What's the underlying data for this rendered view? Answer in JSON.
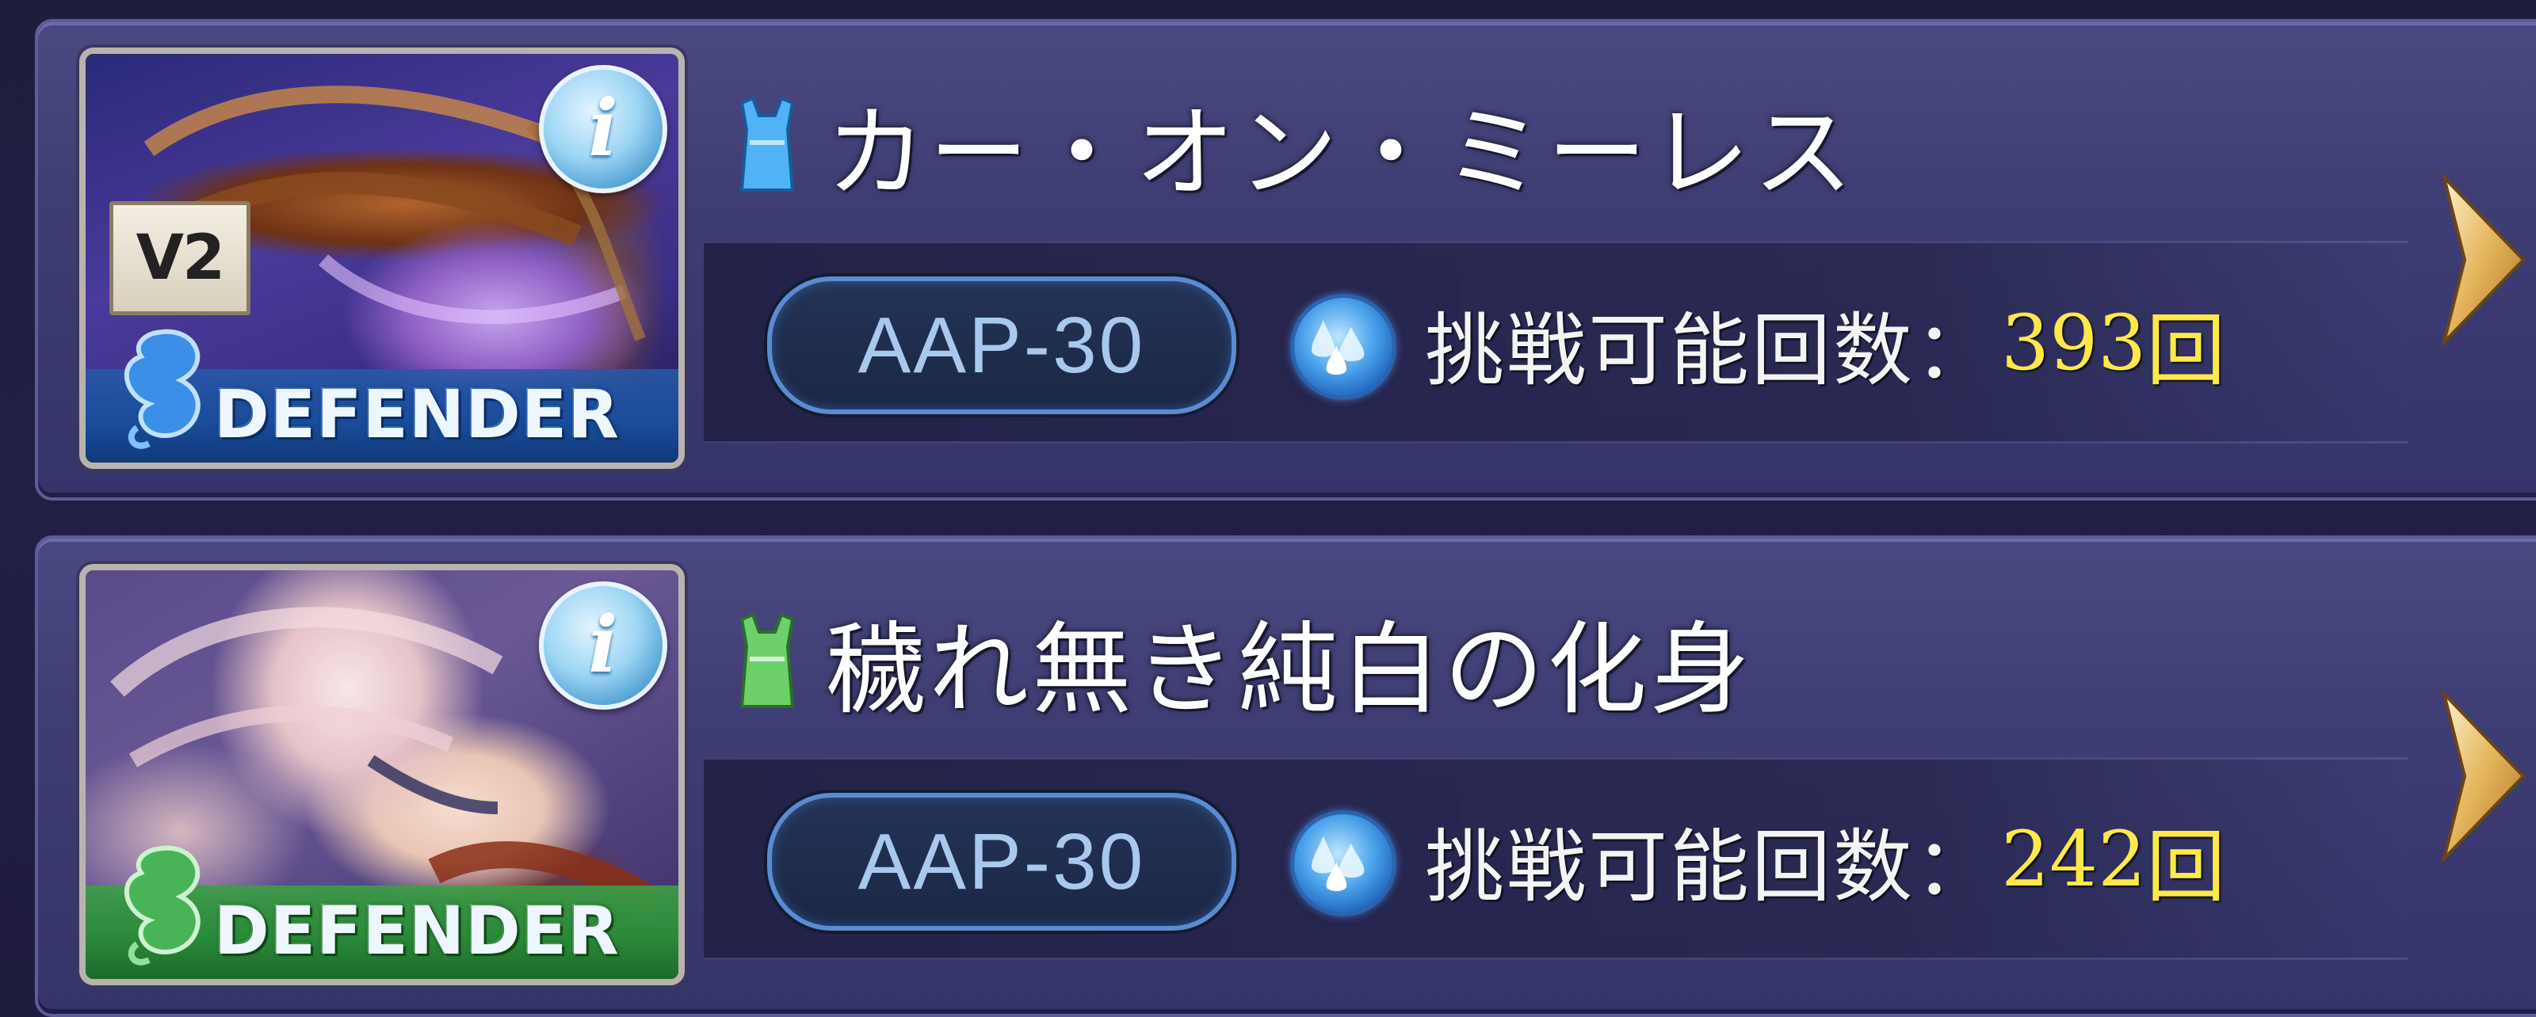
{
  "quests": [
    {
      "name": "カー・オン・ミーレス",
      "element": "water",
      "element_color": "#4fb3f5",
      "version_badge": "V2",
      "role": "DEFENDER",
      "role_color": "#1a4d9c",
      "info_icon_glyph": "i",
      "level": "AAP-30",
      "attempts_label": "挑戦可能回数：",
      "attempts_count": "393",
      "attempts_unit": "回",
      "icons": [
        "info-icon",
        "water-element-icon",
        "water-drop-icon",
        "chevron-right-icon"
      ]
    },
    {
      "name": "穢れ無き純白の化身",
      "element": "wind",
      "element_color": "#6ed06a",
      "role": "DEFENDER",
      "role_color": "#2a8a3a",
      "info_icon_glyph": "i",
      "level": "AAP-30",
      "attempts_label": "挑戦可能回数：",
      "attempts_count": "242",
      "attempts_unit": "回",
      "icons": [
        "info-icon",
        "wind-element-icon",
        "water-drop-icon",
        "chevron-right-icon"
      ]
    }
  ],
  "colors": {
    "background": "#221f45",
    "row": "#3f3e74",
    "count_highlight": "#ffe94a",
    "level_text": "#a9c8ee"
  }
}
